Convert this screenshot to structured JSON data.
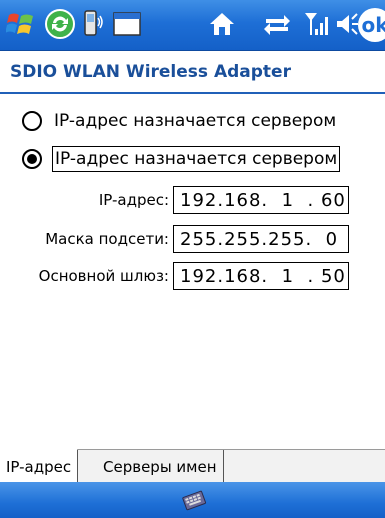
{
  "statusbar": {
    "ok_label": "ok"
  },
  "header": {
    "title": "SDIO WLAN Wireless Adapter"
  },
  "options": [
    {
      "label": "IP-адрес назначается сервером",
      "checked": false
    },
    {
      "label": "IP-адрес назначается сервером",
      "checked": true
    }
  ],
  "fields": {
    "ip_label": "IP-адрес:",
    "ip_value": "192.168.  1  . 60",
    "mask_label": "Маска подсети:",
    "mask_value": "255.255.255.  0",
    "gateway_label": "Основной шлюз:",
    "gateway_value": "192.168.  1  . 50"
  },
  "tabs": [
    {
      "label": "IP-адрес",
      "active": true
    },
    {
      "label": "Серверы имен",
      "active": false
    }
  ],
  "colors": {
    "titlebar": "#1e6fd6",
    "header_text": "#1a4f9a"
  }
}
